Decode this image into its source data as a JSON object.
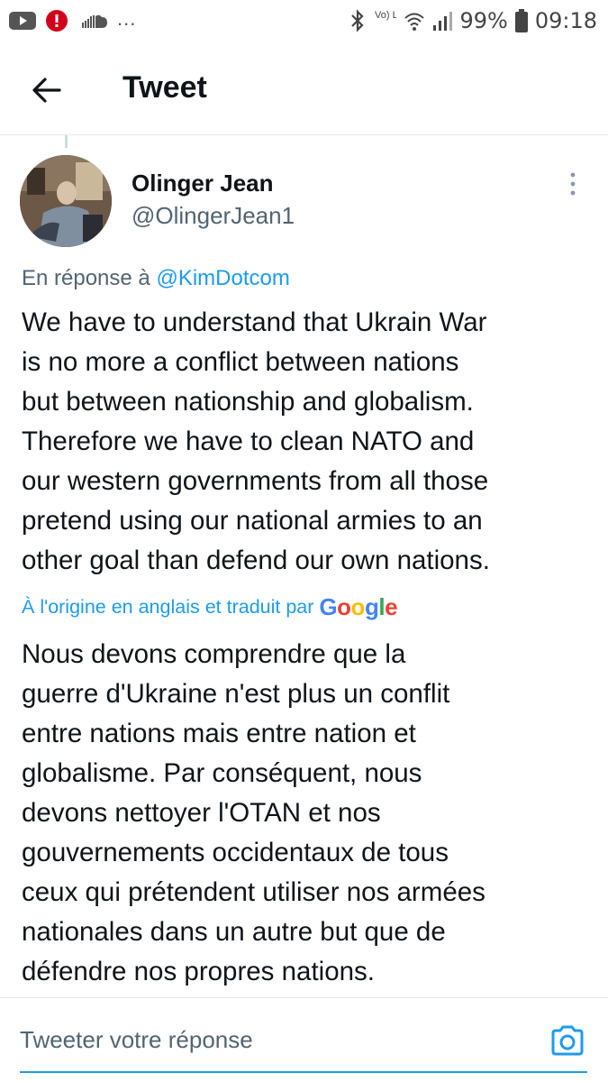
{
  "status_bar": {
    "notification_icons": [
      "youtube-icon",
      "alert-icon",
      "soundcloud-icon"
    ],
    "more_indicator": "...",
    "network_label": "Vo) LTE",
    "battery": "99%",
    "time": "09:18"
  },
  "header": {
    "title": "Tweet"
  },
  "tweet": {
    "author_name": "Olinger Jean",
    "author_handle": "@OlingerJean1",
    "reply_prefix": "En réponse à",
    "reply_mention": "@KimDotcom",
    "text_lines": [
      "We have to understand that Ukrain War",
      "is no more a conflict between nations",
      "but between nationship and globalism.",
      "Therefore we have to clean NATO and",
      "our western governments from all those",
      "pretend using our national armies to an",
      "other goal than defend our own nations."
    ],
    "translated_by": "À l'origine en anglais et traduit par",
    "translator_brand": [
      "G",
      "o",
      "o",
      "g",
      "l",
      "e"
    ],
    "translation_lines": [
      "Nous devons comprendre que la",
      "guerre d'Ukraine n'est plus un conflit",
      "entre nations mais entre nation et",
      "globalisme. Par conséquent, nous",
      "devons nettoyer l'OTAN et nos",
      "gouvernements occidentaux de tous",
      "ceux qui prétendent utiliser nos armées",
      "nationales dans un autre but que de",
      "défendre nos propres nations."
    ]
  },
  "reply_bar": {
    "placeholder": "Tweeter votre réponse"
  },
  "colors": {
    "accent": "#1d9bf0",
    "text_primary": "#0f1419",
    "text_secondary": "#536471"
  }
}
